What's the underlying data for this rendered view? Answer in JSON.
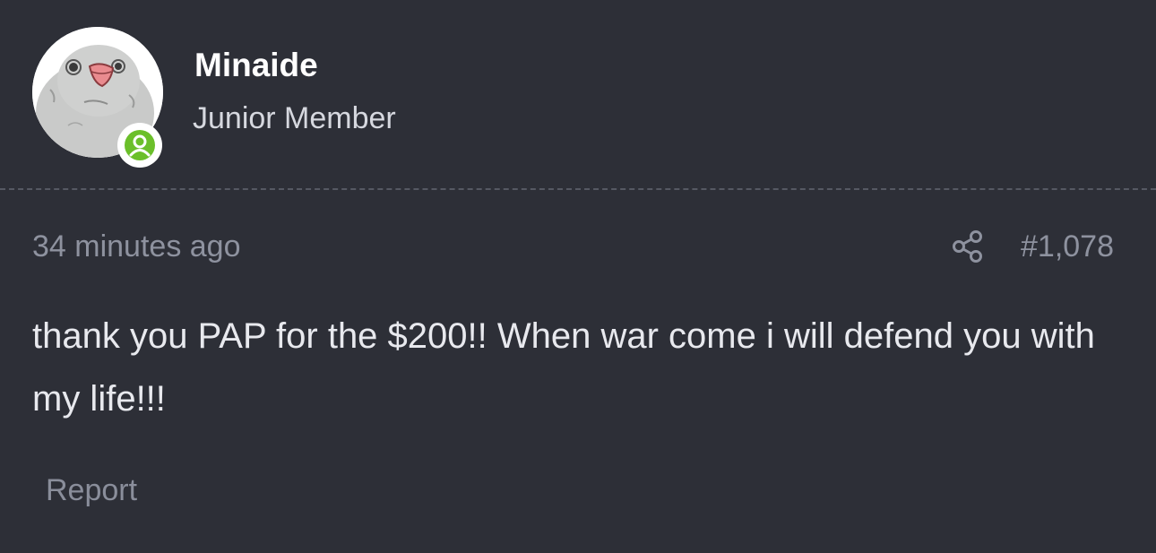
{
  "author": {
    "name": "Minaide",
    "title": "Junior Member",
    "avatar_icon": "bird-avatar",
    "status_icon": "online-user-icon"
  },
  "post": {
    "time_ago": "34 minutes ago",
    "share_icon": "share-icon",
    "number": "#1,078",
    "body": "thank you PAP for the $200!! When war come i will defend you with my life!!!",
    "report_label": "Report"
  },
  "colors": {
    "background": "#2d2f37",
    "online_badge": "#6bbf2a",
    "muted_text": "#8e929f"
  }
}
